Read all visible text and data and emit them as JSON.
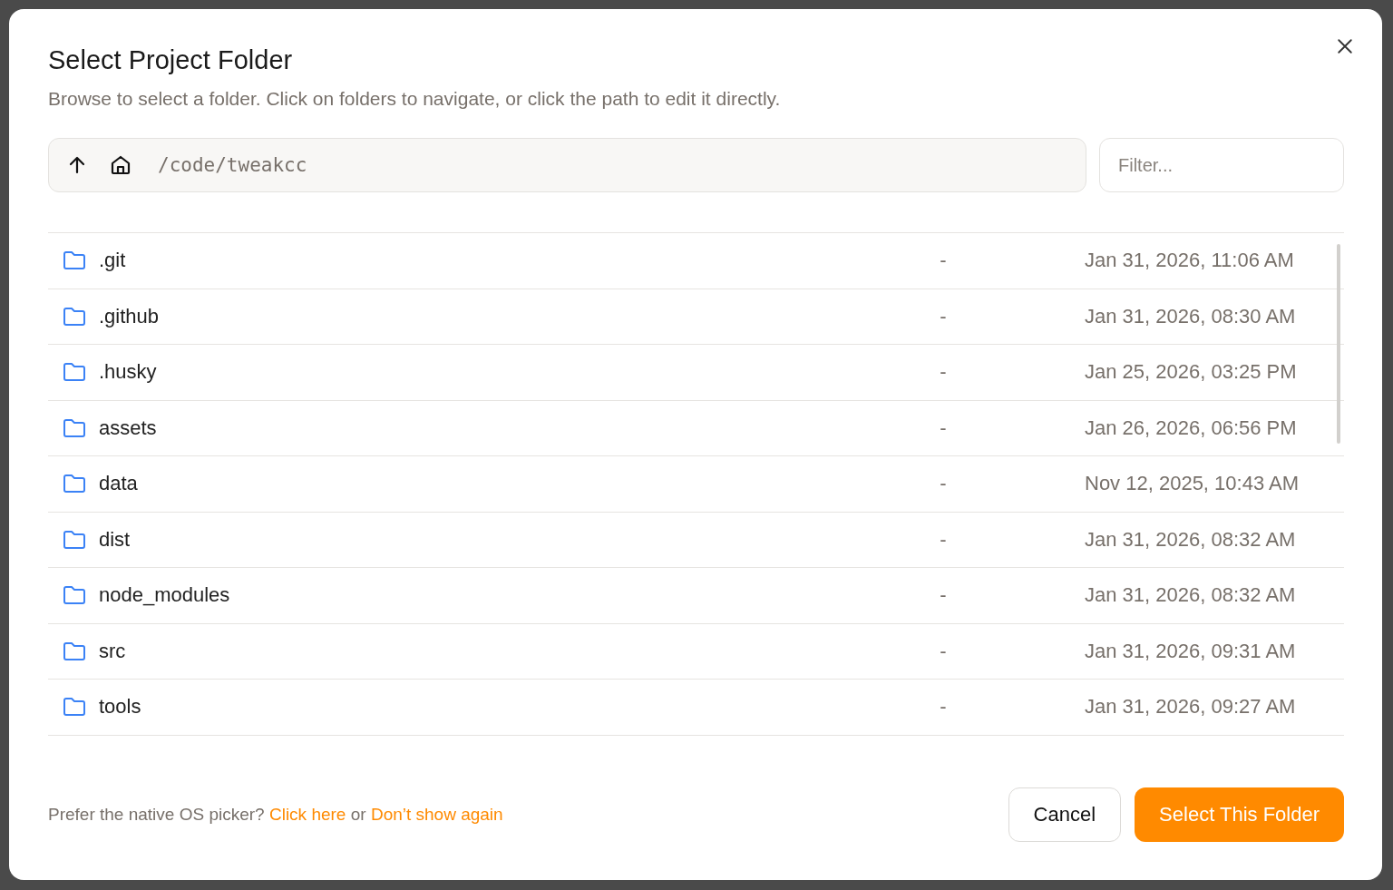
{
  "dialog": {
    "title": "Select Project Folder",
    "subtitle": "Browse to select a folder. Click on folders to navigate, or click the path to edit it directly.",
    "path": "/code/tweakcc",
    "filter": {
      "placeholder": "Filter..."
    },
    "entries": [
      {
        "kind": "folder",
        "name": ".git",
        "size": "-",
        "modified": "Jan 31, 2026, 11:06 AM"
      },
      {
        "kind": "folder",
        "name": ".github",
        "size": "-",
        "modified": "Jan 31, 2026, 08:30 AM"
      },
      {
        "kind": "folder",
        "name": ".husky",
        "size": "-",
        "modified": "Jan 25, 2026, 03:25 PM"
      },
      {
        "kind": "folder",
        "name": "assets",
        "size": "-",
        "modified": "Jan 26, 2026, 06:56 PM"
      },
      {
        "kind": "folder",
        "name": "data",
        "size": "-",
        "modified": "Nov 12, 2025, 10:43 AM"
      },
      {
        "kind": "folder",
        "name": "dist",
        "size": "-",
        "modified": "Jan 31, 2026, 08:32 AM"
      },
      {
        "kind": "folder",
        "name": "node_modules",
        "size": "-",
        "modified": "Jan 31, 2026, 08:32 AM"
      },
      {
        "kind": "folder",
        "name": "src",
        "size": "-",
        "modified": "Jan 31, 2026, 09:31 AM"
      },
      {
        "kind": "folder",
        "name": "tools",
        "size": "-",
        "modified": "Jan 31, 2026, 09:27 AM"
      }
    ],
    "footer": {
      "prompt": "Prefer the native OS picker?",
      "link": "Click here",
      "joiner": "or",
      "second_link": "Don’t show again"
    },
    "buttons": [
      {
        "kind": "secondary",
        "label": "Cancel"
      },
      {
        "kind": "primary",
        "label": "Select This Folder"
      }
    ]
  }
}
